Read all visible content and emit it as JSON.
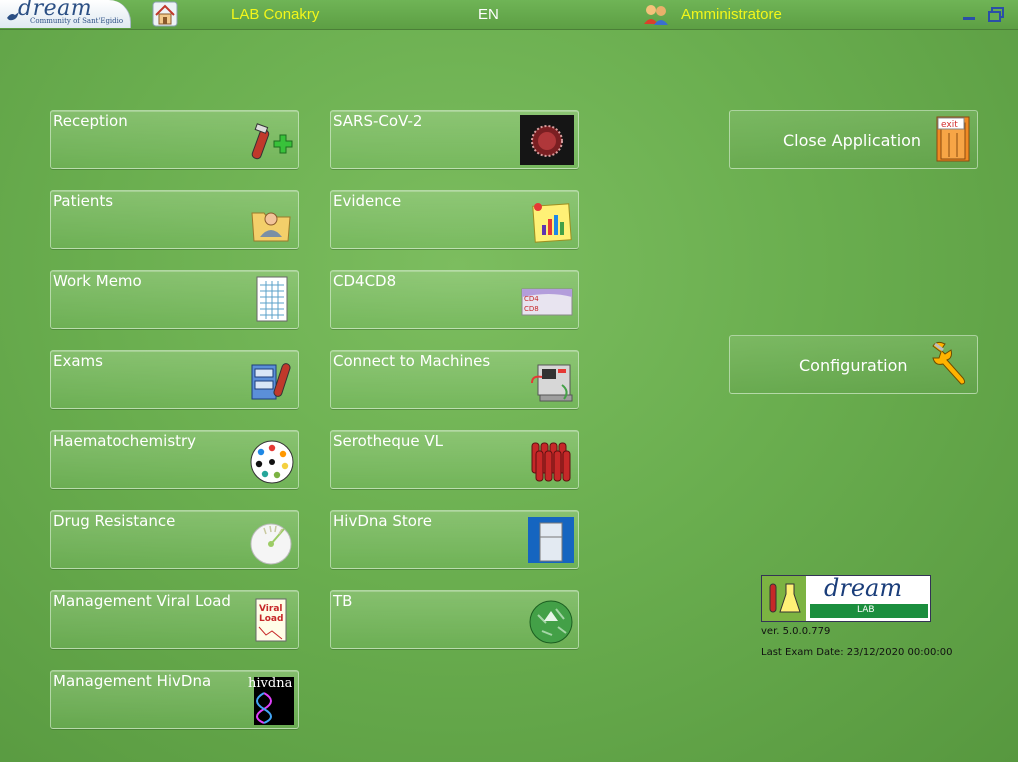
{
  "header": {
    "logo_word": "dream",
    "logo_sub": "Community of Sant'Egidio",
    "lab_name": "LAB Conakry",
    "language": "EN",
    "user": "Amministratore"
  },
  "left_tiles": [
    {
      "label": "Reception",
      "icon": "reception-icon"
    },
    {
      "label": "Patients",
      "icon": "patients-icon"
    },
    {
      "label": "Work Memo",
      "icon": "work-memo-icon"
    },
    {
      "label": "Exams",
      "icon": "exams-icon"
    },
    {
      "label": "Haematochemistry",
      "icon": "haematochemistry-icon"
    },
    {
      "label": "Drug Resistance",
      "icon": "drug-resistance-icon"
    },
    {
      "label": "Management Viral Load",
      "icon": "viral-load-icon"
    },
    {
      "label": "Management HivDna",
      "icon": "hivdna-icon"
    }
  ],
  "mid_tiles": [
    {
      "label": "SARS-CoV-2",
      "icon": "virus-icon"
    },
    {
      "label": "Evidence",
      "icon": "evidence-icon"
    },
    {
      "label": "CD4CD8",
      "icon": "cd4cd8-icon"
    },
    {
      "label": "Connect to Machines",
      "icon": "machine-icon"
    },
    {
      "label": "Serotheque VL",
      "icon": "test-tubes-icon"
    },
    {
      "label": "HivDna Store",
      "icon": "freezer-icon"
    },
    {
      "label": "TB",
      "icon": "tb-icon"
    }
  ],
  "icon_text": {
    "exit": "exit",
    "viral_load": [
      "Viral",
      "Load"
    ],
    "hivdna": "hivdna",
    "cd4": "CD4",
    "cd8": "CD8"
  },
  "right_buttons": {
    "close_label": "Close Application",
    "config_label": "Configuration"
  },
  "footer": {
    "logo_word": "dream",
    "logo_sub": "LAB",
    "version": "ver. 5.0.0.779",
    "last_exam": "Last Exam Date: 23/12/2020 00:00:00"
  },
  "colors": {
    "background": "#6aae4f",
    "topbar_text": "#f3f71a",
    "label": "#ffffff"
  }
}
